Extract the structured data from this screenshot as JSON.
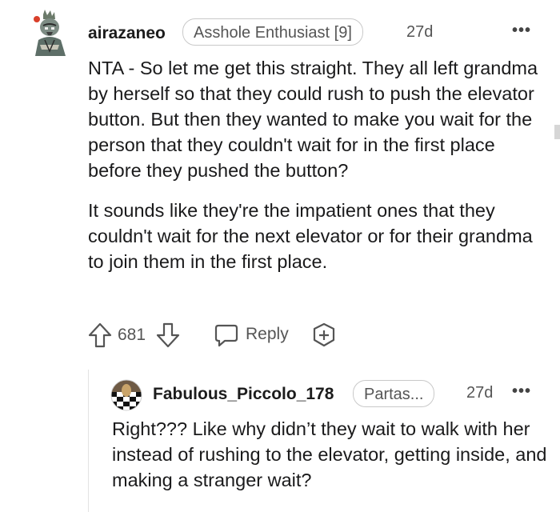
{
  "comment": {
    "username": "airazaneo",
    "flair": "Asshole Enthusiast [9]",
    "time": "27d",
    "more": "•••",
    "paragraphs": [
      "NTA - So let me get this straight. They all left grandma by herself so that they could rush to push the elevator button. But then they wanted to make you wait for the person that they couldn't wait for in the first place before they pushed the button?",
      "It sounds like they're the impatient ones that they couldn't wait for the next elevator or for their grandma to join them in the first place."
    ],
    "votes": "681",
    "reply_label": "Reply",
    "icons": [
      "upvote-icon",
      "downvote-icon",
      "reply-icon",
      "award-icon",
      "more-icon"
    ]
  },
  "reply": {
    "username": "Fabulous_Piccolo_178",
    "flair": "Partas...",
    "time": "27d",
    "more": "•••",
    "text": "Right??? Like why didn’t they wait to walk with her instead of rushing to the elevator, getting inside, and making a stranger wait?"
  },
  "colors": {
    "text": "#1a1a1b",
    "muted": "#555555",
    "flair_border": "#c9c9c9",
    "thread_line": "#e3e3e3"
  }
}
